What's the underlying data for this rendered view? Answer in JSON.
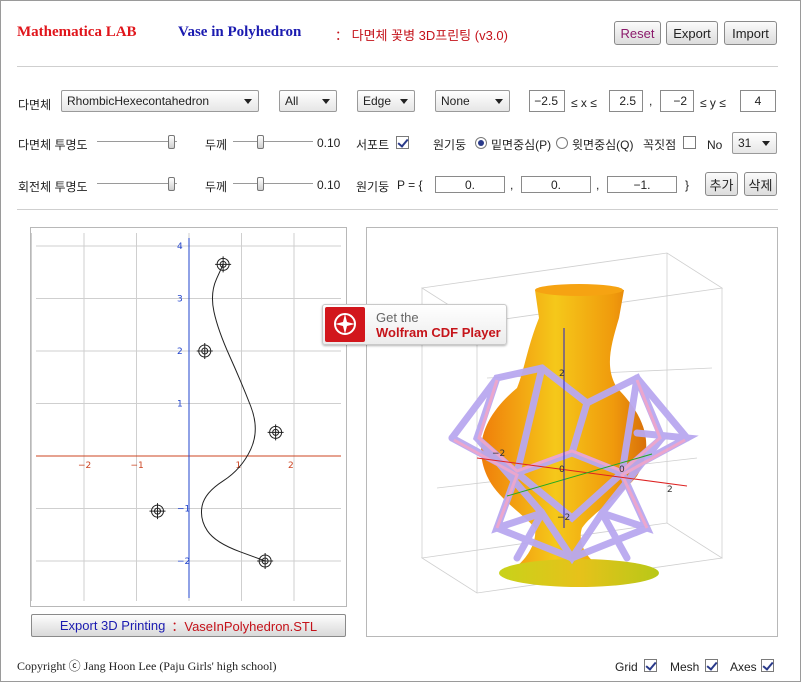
{
  "header": {
    "lab": "Mathematica LAB",
    "app_name": "Vase in Polyhedron",
    "subtitle": "： 다면체 꽃병 3D프린팅 (v3.0)",
    "reset": "Reset",
    "export": "Export",
    "import": "Import"
  },
  "row1": {
    "polyhedron_label": "다면체",
    "polyhedron_value": "RhombicHexecontahedron",
    "all_value": "All",
    "edge_value": "Edge",
    "none_value": "None",
    "xmin": "−2.5",
    "x_le": "≤ x ≤",
    "xmax": "2.5",
    "comma": ",",
    "ymin": "−2",
    "y_le": "≤ y ≤",
    "ymax": "4"
  },
  "row2": {
    "poly_opacity_label": "다면체 투명도",
    "thickness_label": "두께",
    "thickness_value": "0.10",
    "support_label": "서포트",
    "cylinder_label": "원기둥",
    "radio_p": "밑면중심(P)",
    "radio_q": "윗면중심(Q)",
    "vertex_label": "꼭짓점",
    "no_label": "No",
    "no_value": "31"
  },
  "row3": {
    "rev_opacity_label": "회전체 투명도",
    "thickness_label": "두께",
    "thickness_value": "0.10",
    "cylinder_label": "원기둥",
    "p_label": "P = {",
    "p1": "0.",
    "p2": "0.",
    "p3": "−1.",
    "sep": ",",
    "close": "}",
    "add": "추가",
    "delete": "삭제"
  },
  "plot2d": {
    "x_ticks": [
      "−2",
      "−1",
      "1",
      "2"
    ],
    "y_ticks": [
      "4",
      "3",
      "2",
      "1",
      "−1",
      "−2"
    ],
    "control_points": [
      {
        "x": 0.65,
        "y": 3.65
      },
      {
        "x": 0.3,
        "y": 2.0
      },
      {
        "x": 1.65,
        "y": 0.45
      },
      {
        "x": -0.6,
        "y": -1.05
      },
      {
        "x": 1.45,
        "y": -2.0
      }
    ]
  },
  "plot3d": {
    "axis_labels": [
      "2",
      "0",
      "−2",
      "−2",
      "0",
      "2"
    ]
  },
  "cdf": {
    "line1": "Get the",
    "line2": "Wolfram CDF Player"
  },
  "export_button": {
    "prefix": "Export 3D Printing",
    "file": "：VaseInPolyhedron.STL"
  },
  "footer": {
    "copyright": "Copyright ⓒ Jang Hoon Lee (Paju Girls' high school)",
    "grid": "Grid",
    "mesh": "Mesh",
    "axes": "Axes"
  },
  "colors": {
    "accent_red": "#e0151b",
    "accent_blue": "#1b1bb0",
    "vase": "#f2b80d",
    "polyhedron": "#b9a8f0"
  }
}
